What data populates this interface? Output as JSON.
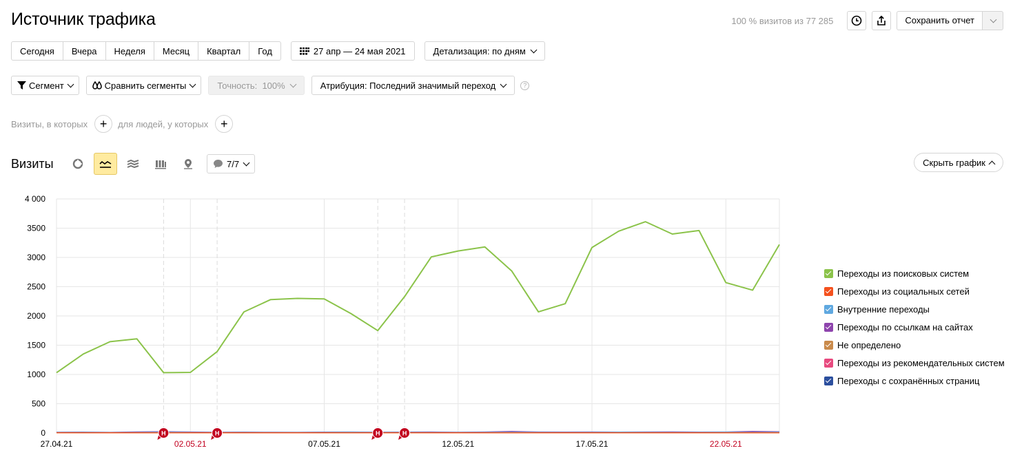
{
  "header": {
    "title": "Источник трафика",
    "visits_share": "100 % визитов из 77 285",
    "save_label": "Сохранить отчет"
  },
  "periods": [
    "Сегодня",
    "Вчера",
    "Неделя",
    "Месяц",
    "Квартал",
    "Год"
  ],
  "date_range": "27 апр — 24 мая 2021",
  "detail": "Детализация: по дням",
  "segment": "Сегмент",
  "compare": "Сравнить сегменты",
  "accuracy": "Точность:  100%",
  "attribution": "Атрибуция: Последний значимый переход",
  "filters": {
    "visits_label": "Визиты, в которых",
    "people_label": "для людей, у которых"
  },
  "section": {
    "title": "Визиты",
    "notes_count": "7/7",
    "hide_chart": "Скрыть график"
  },
  "colors": {
    "accent": "#ffeba0",
    "holiday": "#c2001f"
  },
  "chart_data": {
    "type": "line",
    "y_ticks": [
      "4 000",
      "3500",
      "3000",
      "2500",
      "2000",
      "1500",
      "1000",
      "500",
      "0"
    ],
    "x_tick_labels": [
      {
        "label": "27.04.21",
        "holiday": false
      },
      {
        "label": "02.05.21",
        "holiday": true
      },
      {
        "label": "07.05.21",
        "holiday": false
      },
      {
        "label": "12.05.21",
        "holiday": false
      },
      {
        "label": "17.05.21",
        "holiday": false
      },
      {
        "label": "22.05.21",
        "holiday": true
      }
    ],
    "ylim": [
      0,
      4000
    ],
    "grid": true,
    "legend_position": "right",
    "annotation_marker": "Н",
    "annotation_days": [
      "01.05.21",
      "03.05.21",
      "09.05.21",
      "10.05.21"
    ],
    "dates": [
      "27.04.21",
      "28.04.21",
      "29.04.21",
      "30.04.21",
      "01.05.21",
      "02.05.21",
      "03.05.21",
      "04.05.21",
      "05.05.21",
      "06.05.21",
      "07.05.21",
      "08.05.21",
      "09.05.21",
      "10.05.21",
      "11.05.21",
      "12.05.21",
      "13.05.21",
      "14.05.21",
      "15.05.21",
      "16.05.21",
      "17.05.21",
      "18.05.21",
      "19.05.21",
      "20.05.21",
      "21.05.21",
      "22.05.21",
      "23.05.21",
      "24.05.21"
    ],
    "series": [
      {
        "name": "Переходы из поисковых систем",
        "color": "#8bc34a",
        "values": [
          1030,
          1350,
          1560,
          1610,
          1030,
          1035,
          1390,
          2070,
          2280,
          2300,
          2290,
          2040,
          1750,
          2330,
          3010,
          3110,
          3180,
          2770,
          2070,
          2210,
          3170,
          3450,
          3610,
          3400,
          3460,
          2570,
          2440,
          3220
        ]
      },
      {
        "name": "Переходы из социальных сетей",
        "color": "#f4511e",
        "values": [
          5,
          5,
          5,
          5,
          5,
          5,
          5,
          5,
          5,
          5,
          5,
          5,
          5,
          5,
          5,
          5,
          5,
          5,
          5,
          5,
          5,
          5,
          5,
          5,
          5,
          5,
          5,
          5
        ]
      },
      {
        "name": "Внутренние переходы",
        "color": "#5fa8e0",
        "values": [
          10,
          12,
          8,
          10,
          14,
          11,
          9,
          12,
          10,
          10,
          12,
          14,
          10,
          12,
          11,
          10,
          12,
          14,
          12,
          10,
          12,
          14,
          12,
          10,
          12,
          14,
          12,
          14
        ]
      },
      {
        "name": "Переходы по ссылкам на сайтах",
        "color": "#8e44ad",
        "values": [
          12,
          14,
          10,
          18,
          22,
          16,
          12,
          14,
          12,
          10,
          14,
          16,
          12,
          14,
          16,
          12,
          16,
          26,
          16,
          14,
          16,
          14,
          16,
          18,
          14,
          16,
          26,
          20
        ]
      },
      {
        "name": "Не определено",
        "color": "#c98a4b",
        "values": [
          2,
          2,
          2,
          2,
          2,
          2,
          2,
          2,
          2,
          2,
          2,
          2,
          2,
          2,
          2,
          2,
          2,
          2,
          2,
          2,
          2,
          2,
          2,
          2,
          2,
          2,
          2,
          2
        ]
      },
      {
        "name": "Переходы из рекомендательных систем",
        "color": "#e84a7f",
        "values": [
          3,
          3,
          3,
          3,
          3,
          3,
          3,
          3,
          3,
          3,
          3,
          3,
          3,
          3,
          3,
          3,
          3,
          3,
          3,
          3,
          3,
          3,
          3,
          3,
          3,
          3,
          3,
          3
        ]
      },
      {
        "name": "Переходы с сохранённых страниц",
        "color": "#2c4f9e",
        "values": [
          6,
          6,
          6,
          6,
          6,
          6,
          6,
          6,
          6,
          6,
          6,
          6,
          6,
          6,
          6,
          6,
          6,
          6,
          6,
          6,
          6,
          6,
          6,
          6,
          6,
          6,
          6,
          6
        ]
      }
    ]
  }
}
